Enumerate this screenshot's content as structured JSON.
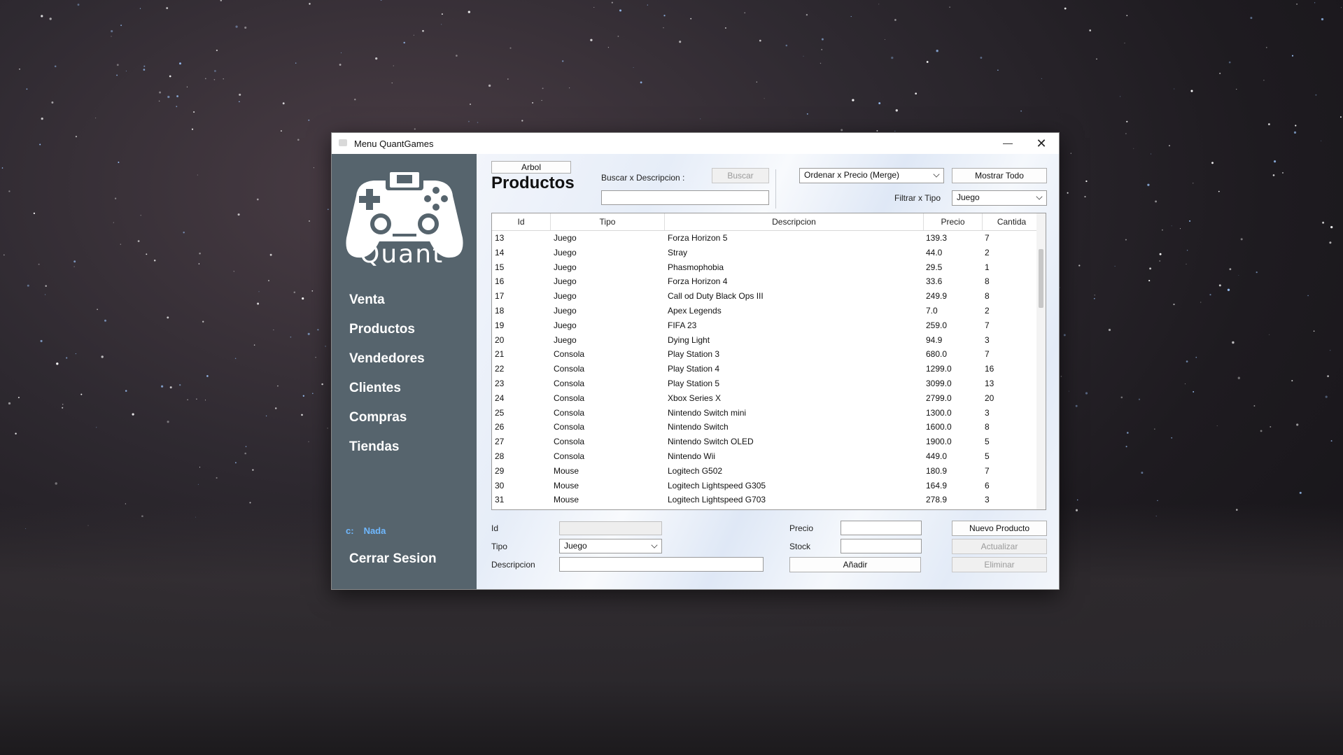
{
  "window": {
    "title": "Menu QuantGames"
  },
  "sidebar": {
    "logo_text": "Quant",
    "items": [
      {
        "label": "Venta"
      },
      {
        "label": "Productos"
      },
      {
        "label": "Vendedores"
      },
      {
        "label": "Clientes"
      },
      {
        "label": "Compras"
      },
      {
        "label": "Tiendas"
      }
    ],
    "status_prefix": "c:",
    "status_value": "Nada",
    "logout": "Cerrar Sesion"
  },
  "main": {
    "tree_button": "Arbol",
    "title": "Productos",
    "search_label": "Buscar x Descripcion :",
    "search_button": "Buscar",
    "sort_select": "Ordenar x Precio (Merge)",
    "show_all_button": "Mostrar Todo",
    "filter_label": "Filtrar x Tipo",
    "filter_select": "Juego"
  },
  "table": {
    "columns": [
      "Id",
      "Tipo",
      "Descripcion",
      "Precio",
      "Cantida"
    ],
    "rows": [
      [
        "13",
        "Juego",
        "Forza Horizon 5",
        "139.3",
        "7"
      ],
      [
        "14",
        "Juego",
        "Stray",
        "44.0",
        "2"
      ],
      [
        "15",
        "Juego",
        "Phasmophobia",
        "29.5",
        "1"
      ],
      [
        "16",
        "Juego",
        "Forza Horizon 4",
        "33.6",
        "8"
      ],
      [
        "17",
        "Juego",
        "Call od Duty Black Ops III",
        "249.9",
        "8"
      ],
      [
        "18",
        "Juego",
        "Apex Legends",
        "7.0",
        "2"
      ],
      [
        "19",
        "Juego",
        "FIFA 23",
        "259.0",
        "7"
      ],
      [
        "20",
        "Juego",
        "Dying Light",
        "94.9",
        "3"
      ],
      [
        "21",
        "Consola",
        "Play Station 3",
        "680.0",
        "7"
      ],
      [
        "22",
        "Consola",
        "Play Station 4",
        "1299.0",
        "16"
      ],
      [
        "23",
        "Consola",
        "Play Station 5",
        "3099.0",
        "13"
      ],
      [
        "24",
        "Consola",
        "Xbox Series X",
        "2799.0",
        "20"
      ],
      [
        "25",
        "Consola",
        "Nintendo Switch mini",
        "1300.0",
        "3"
      ],
      [
        "26",
        "Consola",
        "Nintendo Switch",
        "1600.0",
        "8"
      ],
      [
        "27",
        "Consola",
        "Nintendo Switch OLED",
        "1900.0",
        "5"
      ],
      [
        "28",
        "Consola",
        "Nintendo Wii",
        "449.0",
        "5"
      ],
      [
        "29",
        "Mouse",
        "Logitech G502",
        "180.9",
        "7"
      ],
      [
        "30",
        "Mouse",
        "Logitech Lightspeed G305",
        "164.9",
        "6"
      ],
      [
        "31",
        "Mouse",
        "Logitech Lightspeed G703",
        "278.9",
        "3"
      ]
    ]
  },
  "form": {
    "id_label": "Id",
    "id_value": "",
    "tipo_label": "Tipo",
    "tipo_value": "Juego",
    "descripcion_label": "Descripcion",
    "descripcion_value": "",
    "precio_label": "Precio",
    "precio_value": "",
    "stock_label": "Stock",
    "stock_value": "",
    "add_button": "Añadir",
    "new_button": "Nuevo Producto",
    "update_button": "Actualizar",
    "delete_button": "Eliminar"
  },
  "colors": {
    "sidebar_bg": "#56646d",
    "status_accent": "#6fb8ff"
  }
}
